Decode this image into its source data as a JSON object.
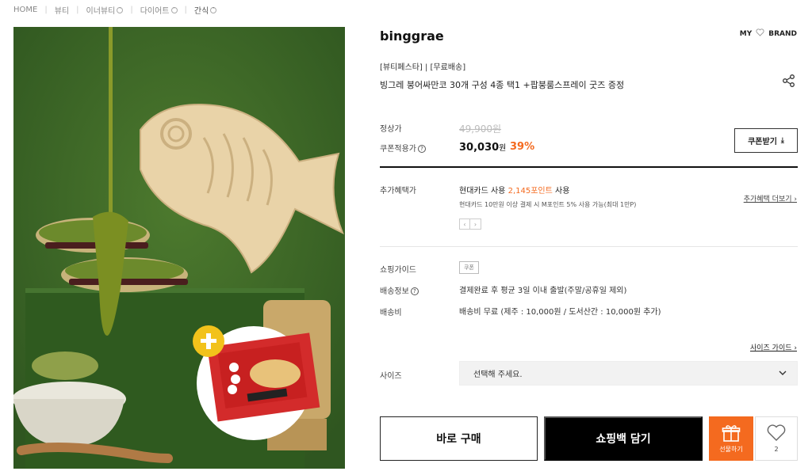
{
  "breadcrumb": [
    {
      "label": "HOME",
      "dropdown": false
    },
    {
      "label": "뷰티",
      "dropdown": false
    },
    {
      "label": "이너뷰티",
      "dropdown": true
    },
    {
      "label": "다이어트",
      "dropdown": true
    },
    {
      "label": "간식",
      "dropdown": true
    }
  ],
  "header": {
    "brand": "binggrae",
    "my_label": "MY",
    "brand_label": "BRAND"
  },
  "product": {
    "tags": "[뷰티페스타] | [무료배송]",
    "title": "빙그레 붕어싸만코 30개 구성 4종 택1 +팝붕룸스프레이 굿즈 증정"
  },
  "price": {
    "regular_label": "정상가",
    "regular_value": "49,900원",
    "coupon_label": "쿠폰적용가",
    "coupon_value": "30,030",
    "coupon_unit": "원",
    "discount": "39%",
    "coupon_button": "쿠폰받기"
  },
  "benefit": {
    "label": "추가혜택가",
    "card": "현대카드 사용",
    "points": "2,145포인트",
    "points_suffix": "사용",
    "detail": "현대카드 10만원 이상 결제 시 M포인트 5% 사용 가능(최대 1만P)",
    "more": "추가혜택 더보기"
  },
  "shopping": {
    "guide_label": "쇼핑가이드",
    "coupon_tag": "쿠폰",
    "shipping_label": "배송정보",
    "shipping_value": "결제완료 후 평균 3일 이내 출발(주말/공휴일 제외)",
    "fee_label": "배송비",
    "fee_value": "배송비 무료 (제주 : 10,000원 / 도서산간 : 10,000원 추가)"
  },
  "size": {
    "guide": "사이즈 가이드",
    "label": "사이즈",
    "placeholder": "선택해 주세요."
  },
  "actions": {
    "buy": "바로 구매",
    "cart": "쇼핑백 담기",
    "gift": "선물하기",
    "like_count": "2"
  },
  "colors": {
    "accent": "#f46a1f",
    "background_green": "#3c6626"
  }
}
